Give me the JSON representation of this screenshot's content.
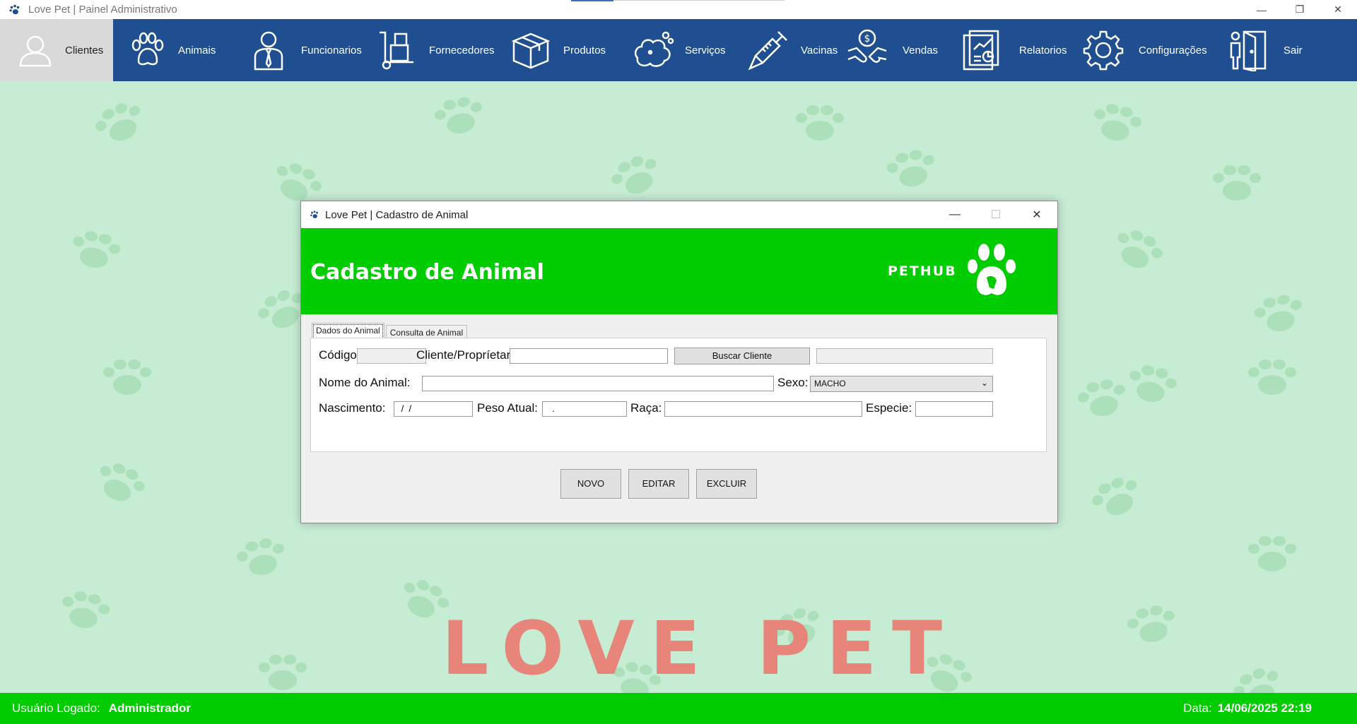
{
  "window": {
    "title": "Love Pet | Painel Administrativo",
    "controls": [
      "—",
      "❐",
      "✕"
    ]
  },
  "menu": {
    "items": [
      {
        "label": "Clientes",
        "icon": "user-icon"
      },
      {
        "label": "Animais",
        "icon": "paw-icon"
      },
      {
        "label": "Funcionarios",
        "icon": "employee-icon"
      },
      {
        "label": "Fornecedores",
        "icon": "hand-truck-icon"
      },
      {
        "label": "Produtos",
        "icon": "box-icon"
      },
      {
        "label": "Serviços",
        "icon": "bath-dog-icon"
      },
      {
        "label": "Vacinas",
        "icon": "syringe-icon"
      },
      {
        "label": "Vendas",
        "icon": "handshake-money-icon"
      },
      {
        "label": "Relatorios",
        "icon": "report-chart-icon"
      },
      {
        "label": "Configurações",
        "icon": "gear-icon"
      },
      {
        "label": "Sair",
        "icon": "exit-door-icon"
      }
    ],
    "active_color": "#d9d9d9",
    "bar_color": "#1f4e91"
  },
  "background": {
    "banner": "LOVE PET",
    "banner_color": "#e7857a"
  },
  "statusbar": {
    "user_label": "Usuário Logado:",
    "user_value": "Administrador",
    "date_label": "Data:",
    "date_value": "14/06/2025 22:19",
    "color": "#00cc00"
  },
  "dialog": {
    "title": "Love Pet | Cadastro de Animal",
    "controls": [
      "—",
      "☐",
      "✕"
    ],
    "header_title": "Cadastro de Animal",
    "logo_text": "PETHUB",
    "tabs": [
      "Dados do Animal",
      "Consulta de Animal"
    ],
    "form": {
      "codigo_label": "Código:",
      "codigo_value": "",
      "cliente_label": "Cliente/Propríetario:",
      "cliente_value": "",
      "buscar_button": "Buscar Cliente",
      "cliente_nome_value": "",
      "nome_label": "Nome do Animal:",
      "nome_value": "",
      "sexo_label": "Sexo:",
      "sexo_value": "MACHO",
      "nascimento_label": "Nascimento:",
      "nascimento_value": " /  /",
      "peso_label": "Peso Atual:",
      "peso_value": "  .",
      "raca_label": "Raça:",
      "raca_value": "",
      "especie_label": "Especie:",
      "especie_value": ""
    },
    "buttons": {
      "novo": "NOVO",
      "editar": "EDITAR",
      "excluir": "EXCLUIR"
    }
  }
}
